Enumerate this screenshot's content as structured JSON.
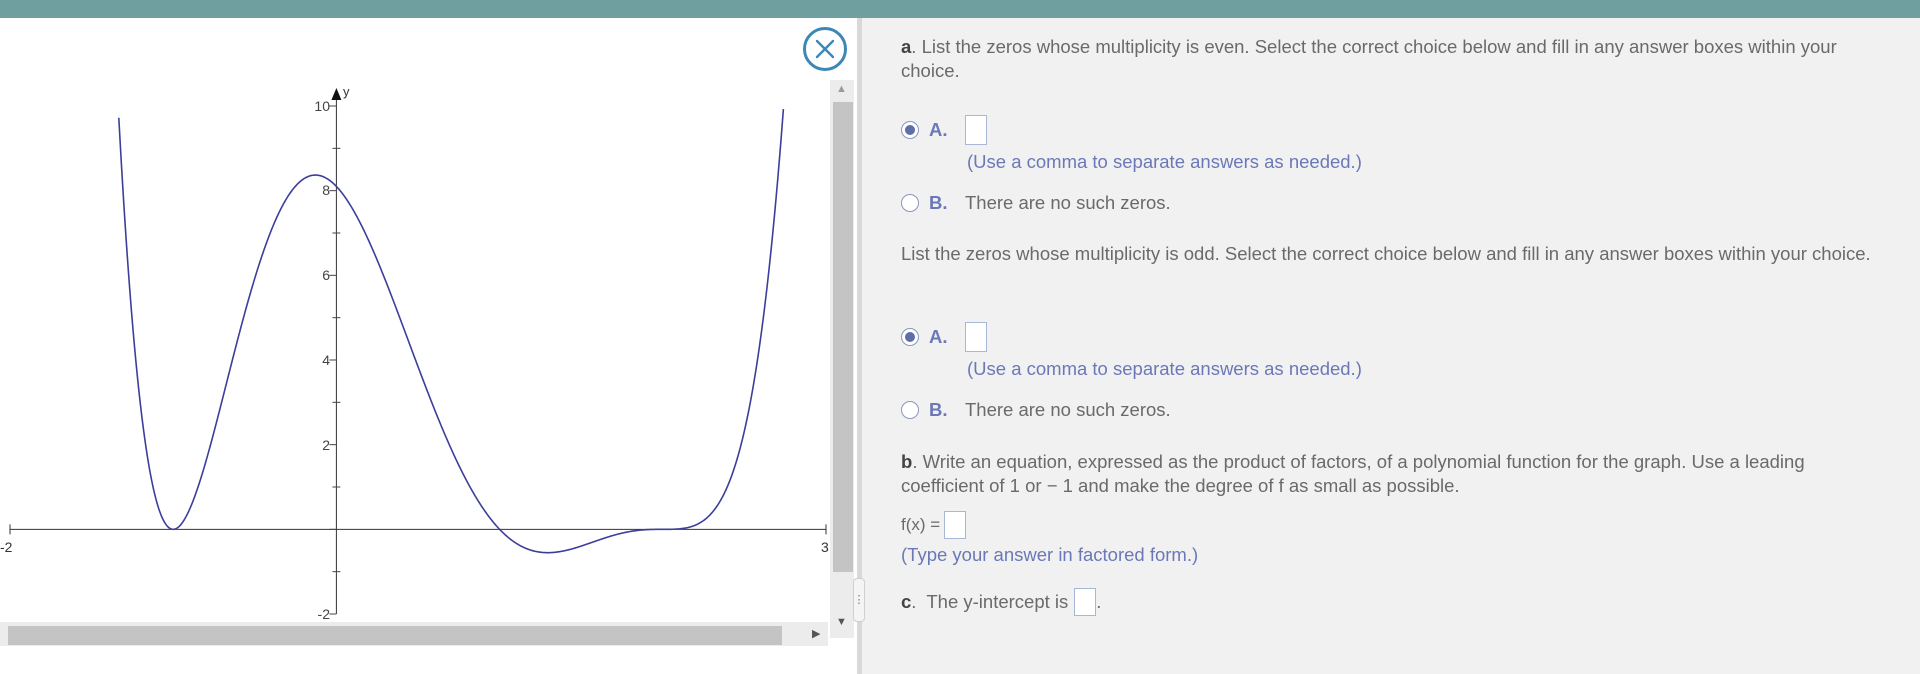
{
  "graph": {
    "x_labels": {
      "min": "-2",
      "max": "3"
    },
    "y_axis_label": "y",
    "y_ticks": [
      "10",
      "8",
      "6",
      "4",
      "2",
      "-2"
    ],
    "curve_color": "#3b3f9a"
  },
  "chart_data": {
    "type": "line",
    "xlim": [
      -2,
      3
    ],
    "ylim": [
      -2,
      10
    ],
    "ylabel": "y",
    "y_tick_labels": [
      10,
      8,
      6,
      4,
      2,
      -2
    ],
    "x_tick_labels": [
      -2,
      3
    ],
    "series": [
      {
        "x": [
          -1.3,
          -1,
          -0.1,
          1,
          2,
          2.7
        ],
        "y": [
          10,
          0,
          8.1,
          0,
          0,
          10
        ]
      }
    ]
  },
  "questions": {
    "a": {
      "letter": "a",
      "prompt": ". List the zeros whose multiplicity is even. Select the correct choice below and fill in any answer boxes within your choice.",
      "optA_letter": "A.",
      "optA_hint": "(Use a comma to separate answers as needed.)",
      "optB_letter": "B.",
      "optB_text": "There are no such zeros.",
      "odd_prompt": "List the zeros whose multiplicity is odd. Select the correct choice below and fill in any answer boxes within your choice.",
      "odd_optA_letter": "A.",
      "odd_optA_hint": "(Use a comma to separate answers as needed.)",
      "odd_optB_letter": "B.",
      "odd_optB_text": "There are no such zeros."
    },
    "b": {
      "letter": "b",
      "prompt": ". Write an equation, expressed as the product of factors, of a polynomial function for the graph. Use a leading coefficient of 1 or − 1 and make the degree of f as small as possible.",
      "fx_label": "f(x) =",
      "hint": "(Type your answer in factored form.)"
    },
    "c": {
      "letter": "c",
      "prompt": ".  The y-intercept is",
      "period": "."
    }
  },
  "colors": {
    "top_bar": "#6fa09f",
    "accent_blue": "#6b78b8",
    "close_ring": "#3d87b7"
  }
}
